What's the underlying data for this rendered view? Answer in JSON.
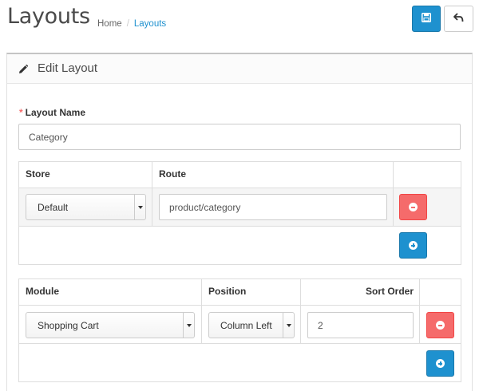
{
  "header": {
    "title": "Layouts",
    "breadcrumb": [
      "Home",
      "Layouts"
    ],
    "breadcrumb_separator": "/"
  },
  "icons": {
    "save": "save-icon",
    "back": "reply-icon",
    "edit": "pencil-icon",
    "remove": "minus-circle-icon",
    "add": "plus-circle-icon"
  },
  "panel": {
    "title": "Edit Layout"
  },
  "form": {
    "layout_name_label": "Layout Name",
    "required_mark": "*",
    "layout_name_value": "Category"
  },
  "routes_table": {
    "headers": {
      "store": "Store",
      "route": "Route"
    },
    "rows": [
      {
        "store": "Default",
        "route": "product/category"
      }
    ]
  },
  "modules_table": {
    "headers": {
      "module": "Module",
      "position": "Position",
      "sort_order": "Sort Order"
    },
    "rows": [
      {
        "module": "Shopping Cart",
        "position": "Column Left",
        "sort_order": "2"
      }
    ]
  },
  "colors": {
    "primary": "#1e91cf",
    "danger": "#f56b6b",
    "required": "#f56b6b"
  }
}
